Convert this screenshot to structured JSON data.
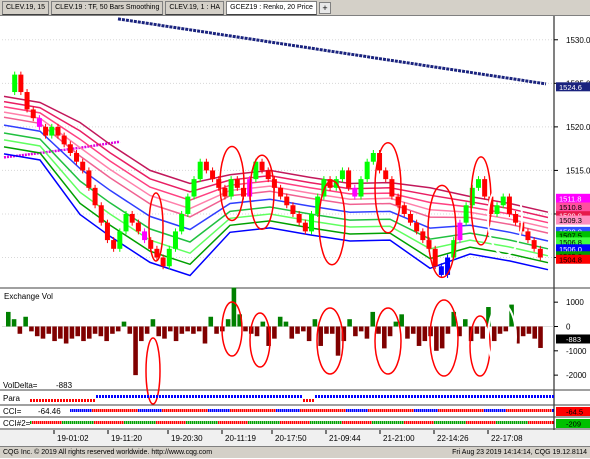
{
  "tabs": [
    {
      "label": "CLEV.19, 15",
      "active": false
    },
    {
      "label": "CLEV.19 : TF, 50 Bars Smoothing",
      "active": false
    },
    {
      "label": "CLEV.19, 1 : HA",
      "active": false
    },
    {
      "label": "GCEZ19 : Renko, 20 Price",
      "active": true
    }
  ],
  "tab_add_label": "+",
  "price_axis": {
    "ticks": [
      "1530.0",
      "1525.0",
      "1520.0",
      "1515.0",
      "1510.0",
      "1505.0"
    ],
    "tick_values": [
      1530,
      1525,
      1520,
      1515,
      1510,
      1505
    ],
    "markers": [
      {
        "text": "1524.6",
        "value": 1524.6,
        "color": "#1a237e",
        "fg": "#ffffff"
      },
      {
        "text": "1511.8",
        "value": 1511.8,
        "color": "#ff00ff",
        "fg": "#ffffff"
      },
      {
        "text": "1510.8",
        "value": 1510.8,
        "color": "#ff4fa0",
        "fg": "#000000"
      },
      {
        "text": "1509.8",
        "value": 1509.8,
        "color": "#e6194b",
        "fg": "#ffffff"
      },
      {
        "text": "1509.3",
        "value": 1509.3,
        "color": "#ff8fc0",
        "fg": "#000000"
      },
      {
        "text": "1508.0",
        "value": 1508.0,
        "color": "#3050ff",
        "fg": "#ffffff"
      },
      {
        "text": "1507.5",
        "value": 1507.5,
        "color": "#00c000",
        "fg": "#000000"
      },
      {
        "text": "1506.8",
        "value": 1506.8,
        "color": "#40ff40",
        "fg": "#000000"
      },
      {
        "text": "1506.0",
        "value": 1506.0,
        "color": "#0000ff",
        "fg": "#ffffff"
      },
      {
        "text": "1505.2",
        "value": 1505.2,
        "color": "#00a000",
        "fg": "#000000"
      },
      {
        "text": "1504.8",
        "value": 1504.8,
        "color": "#ff0000",
        "fg": "#000000"
      }
    ]
  },
  "volume_panel": {
    "title": "Exchange Vol",
    "ticks": [
      "1000",
      "0",
      "-1000",
      "-2000"
    ],
    "tick_values": [
      1000,
      0,
      -1000,
      -2000
    ],
    "last_value_label": "-883",
    "vol_delta_label": "VolDelta=",
    "vol_delta_value": "-883"
  },
  "para_panel": {
    "title": "Para"
  },
  "cci_panel": {
    "title": "CCI=",
    "value": "-64.46",
    "marker": "-64.5"
  },
  "cci2_panel": {
    "title": "CCI#2=",
    "marker": "-209"
  },
  "time_axis": [
    "19-01:02",
    "19-11:20",
    "19-20:30",
    "20-11:19",
    "20-17:50",
    "21-09:44",
    "21-21:00",
    "22-14:26",
    "22-17:08"
  ],
  "footer": {
    "left": "CQG Inc. © 2019 All rights reserved worldwide. http://www.cqg.com",
    "right": "Fri Aug 23 2019 14:14:14, CQG 19.12.8114"
  },
  "colors": {
    "up_bar": "#00ff00",
    "down_bar": "#ff0000",
    "neutral_bar": "#ff00ff",
    "blue_bar": "#0000ff",
    "long_ma": "#1a237e",
    "vol_up": "#008000",
    "vol_down": "#800000",
    "highlight_circle": "#ff0000",
    "white_circle": "#ffffff"
  }
}
